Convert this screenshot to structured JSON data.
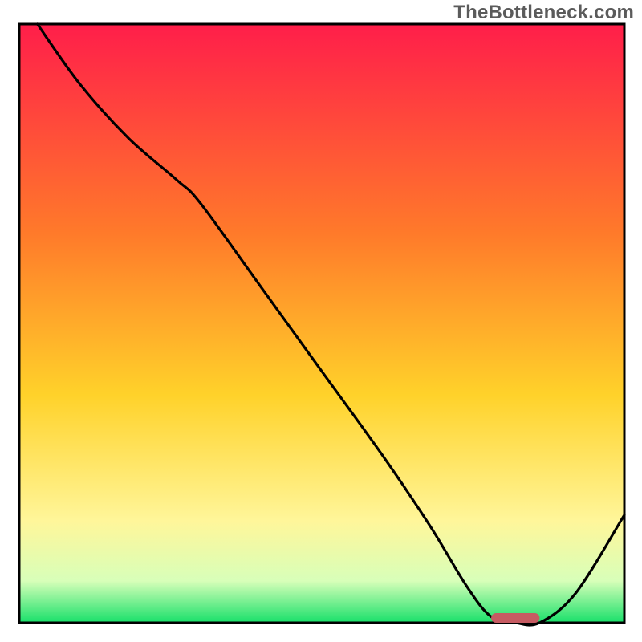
{
  "watermark": "TheBottleneck.com",
  "colors": {
    "top": "#ff1e4a",
    "mid1": "#ff7a2a",
    "mid2": "#ffd22a",
    "mid3": "#fff69a",
    "mid4": "#d8ffb9",
    "bottom": "#18e06a",
    "frame": "#000000",
    "curve": "#000000",
    "marker": "#c65b62"
  },
  "chart_data": {
    "type": "line",
    "title": "",
    "xlabel": "",
    "ylabel": "",
    "xlim": [
      0,
      100
    ],
    "ylim": [
      0,
      100
    ],
    "grid": false,
    "legend": false,
    "series": [
      {
        "name": "bottleneck-curve",
        "x": [
          3,
          10,
          18,
          26,
          30,
          40,
          50,
          60,
          68,
          74,
          78,
          82,
          86,
          92,
          100
        ],
        "y": [
          100,
          90,
          81,
          74,
          70,
          56,
          42,
          28,
          16,
          6,
          1,
          0,
          0,
          5,
          18
        ]
      }
    ],
    "marker": {
      "x_start": 78,
      "x_end": 86,
      "y": 0.8
    },
    "note": "Axis values are relative percentages inferred from the unlabeled plot. The curve descends steeply from top-left, flattens near the bottom around x≈78–86 (the optimal/green zone, marked by the pill), then rises again toward the right edge."
  }
}
